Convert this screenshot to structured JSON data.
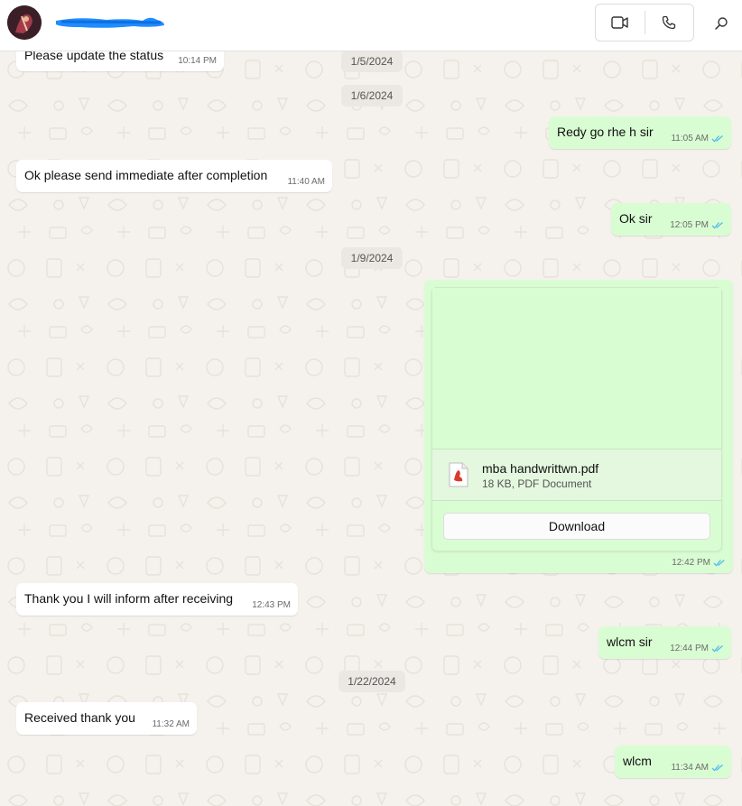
{
  "header": {
    "contact_name_redacted": true,
    "icons": {
      "video": "video-call-icon",
      "voice": "voice-call-icon",
      "search": "search-icon"
    }
  },
  "dates": [
    "1/5/2024",
    "1/6/2024",
    "1/9/2024",
    "1/22/2024"
  ],
  "messages": [
    {
      "dir": "in",
      "text": "Please update the status",
      "time": "10:14 PM"
    },
    {
      "dir": "out",
      "text": "Redy go rhe h sir",
      "time": "11:05 AM"
    },
    {
      "dir": "in",
      "text": "Ok please send immediate after completion",
      "time": "11:40 AM"
    },
    {
      "dir": "out",
      "text": "Ok sir",
      "time": "12:05 PM"
    },
    {
      "dir": "out",
      "type": "document",
      "time": "12:42 PM",
      "document": {
        "name": "mba handwrittwn.pdf",
        "meta": "18 KB, PDF Document",
        "download_label": "Download"
      }
    },
    {
      "dir": "in",
      "text": "Thank you I will inform after receiving",
      "time": "12:43 PM"
    },
    {
      "dir": "out",
      "text": "wlcm sir",
      "time": "12:44 PM"
    },
    {
      "dir": "in",
      "text": "Received thank you",
      "time": "11:32 AM"
    },
    {
      "dir": "out",
      "text": "wlcm",
      "time": "11:34 AM"
    }
  ],
  "colors": {
    "outgoing": "#d9fdd3",
    "incoming": "#ffffff",
    "read_ticks": "#53bdeb",
    "background": "#f5f1ec"
  }
}
